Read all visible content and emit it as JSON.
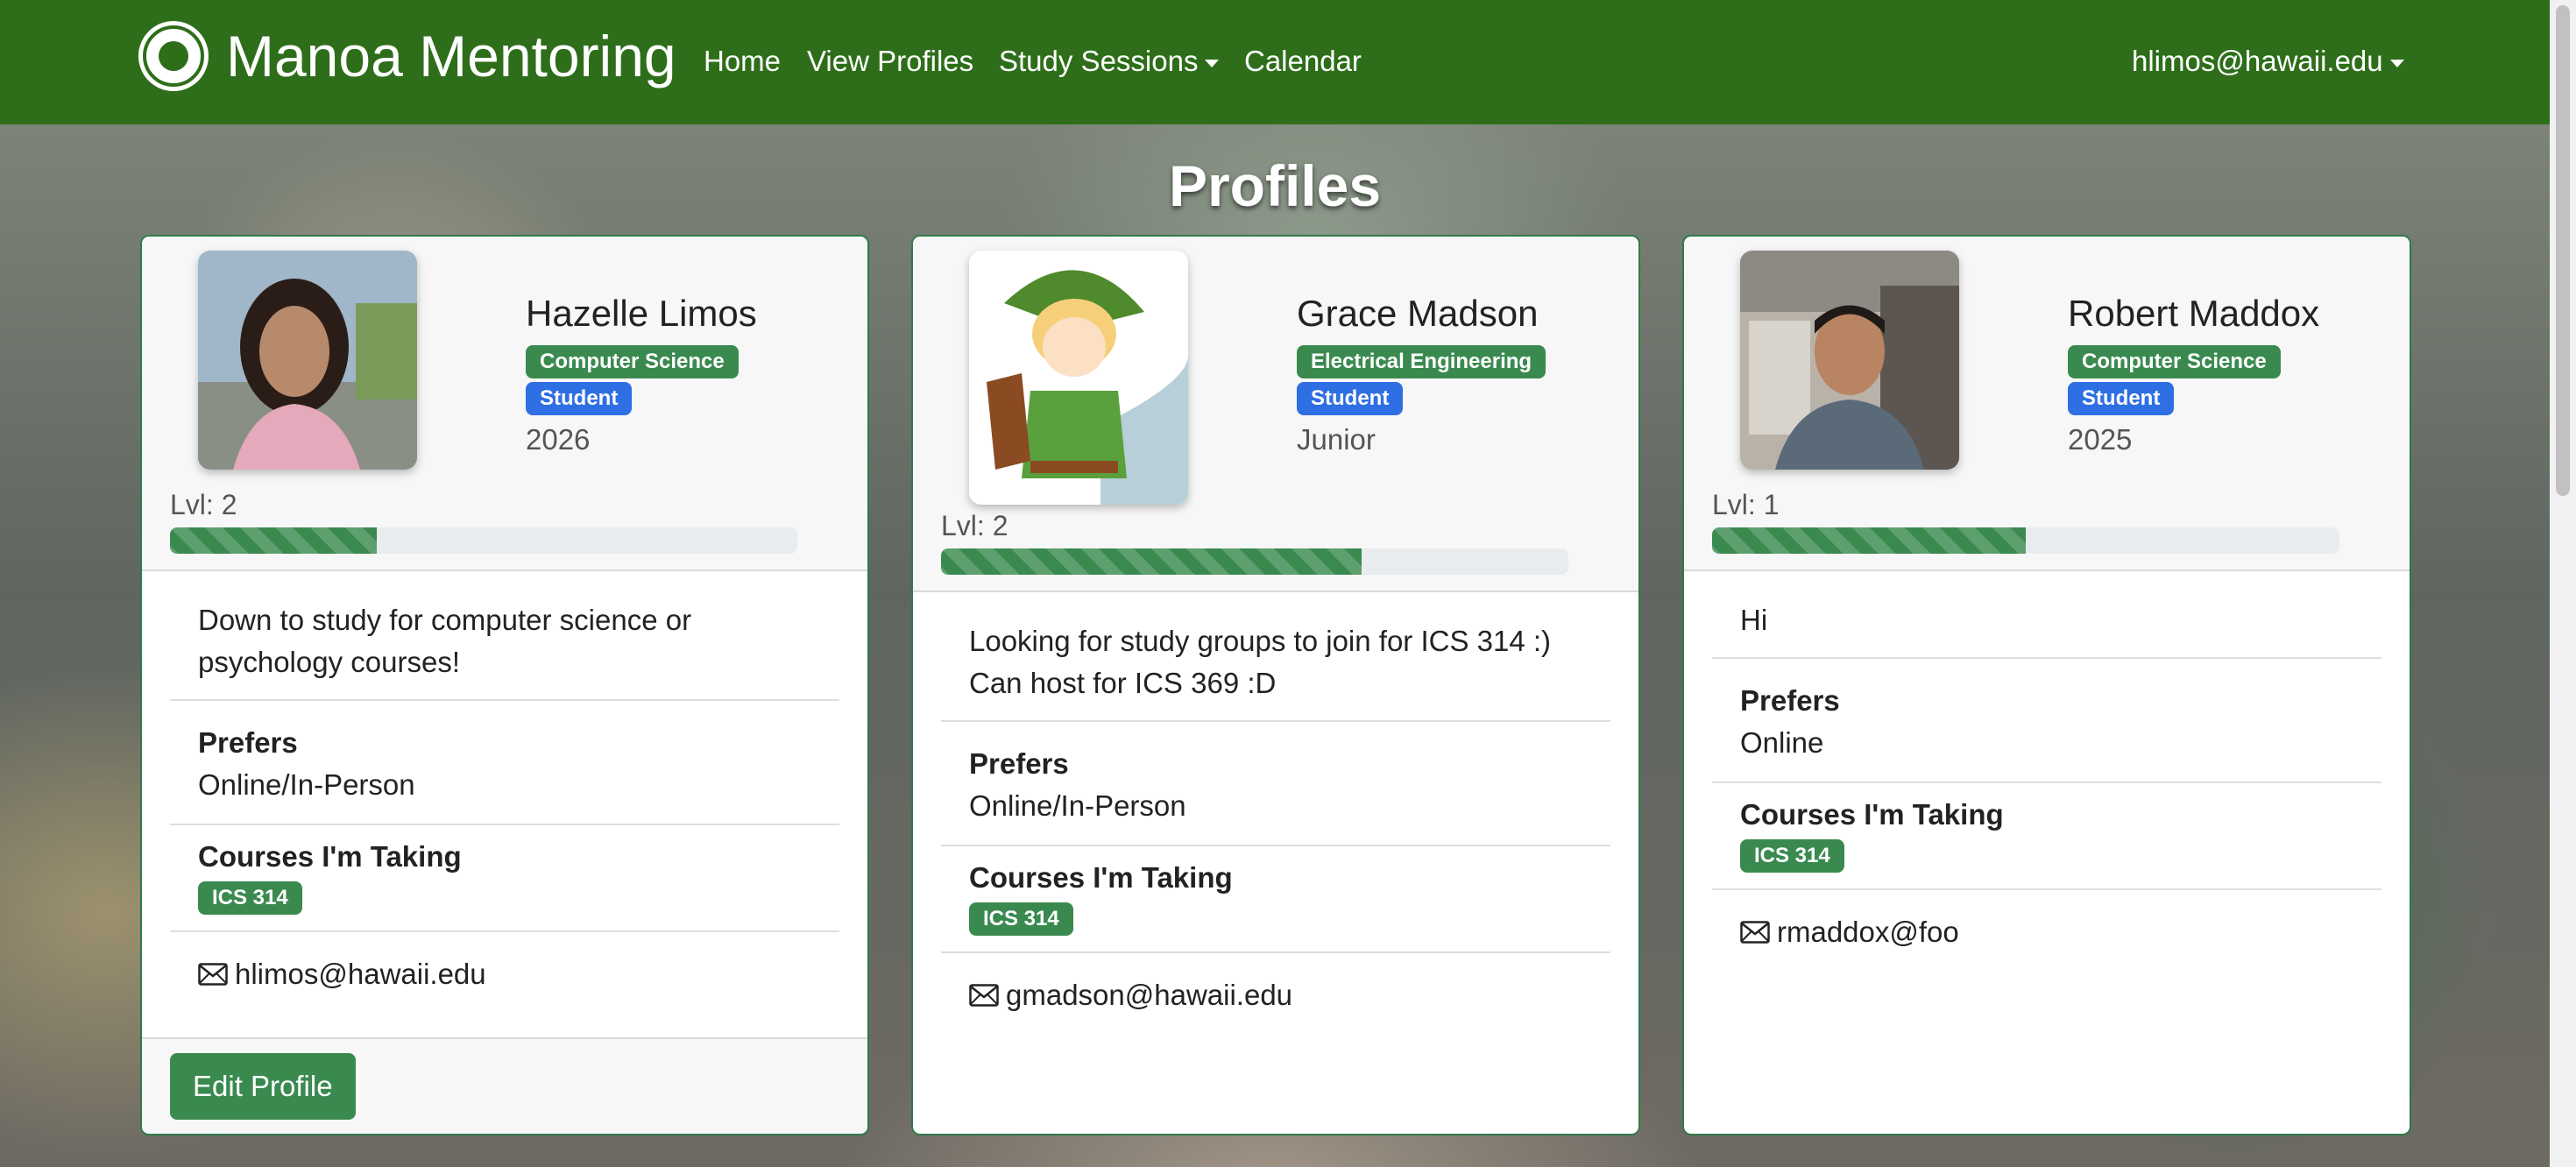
{
  "navbar": {
    "brand": "Manoa Mentoring",
    "links": [
      "Home",
      "View Profiles",
      "Study Sessions",
      "Calendar"
    ],
    "user": "hlimos@hawaii.edu"
  },
  "page": {
    "title": "Profiles"
  },
  "labels": {
    "prefers": "Prefers",
    "courses": "Courses I'm Taking",
    "level_prefix": "Lvl: "
  },
  "profiles": [
    {
      "name": "Hazelle Limos",
      "major": "Computer Science",
      "role": "Student",
      "year": "2026",
      "level": "Lvl: 2",
      "progress_percent": 33,
      "bio": "Down to study for computer science or psychology courses!",
      "prefers": "Online/In-Person",
      "courses": [
        "ICS 314"
      ],
      "email": "hlimos@hawaii.edu",
      "edit_button": "Edit Profile"
    },
    {
      "name": "Grace Madson",
      "major": "Electrical Engineering",
      "role": "Student",
      "year": "Junior",
      "level": "Lvl: 2",
      "progress_percent": 67,
      "bio": "Looking for study groups to join for ICS 314 :) Can host for ICS 369 :D",
      "prefers": "Online/In-Person",
      "courses": [
        "ICS 314"
      ],
      "email": "gmadson@hawaii.edu"
    },
    {
      "name": "Robert Maddox",
      "major": "Computer Science",
      "role": "Student",
      "year": "2025",
      "level": "Lvl: 1",
      "progress_percent": 50,
      "bio": "Hi",
      "prefers": "Online",
      "courses": [
        "ICS 314"
      ],
      "email": "rmaddox@foo"
    }
  ],
  "colors": {
    "navbar": "#2e6e1a",
    "accent": "#3a8a4f",
    "role_badge": "#2f6fe4"
  }
}
